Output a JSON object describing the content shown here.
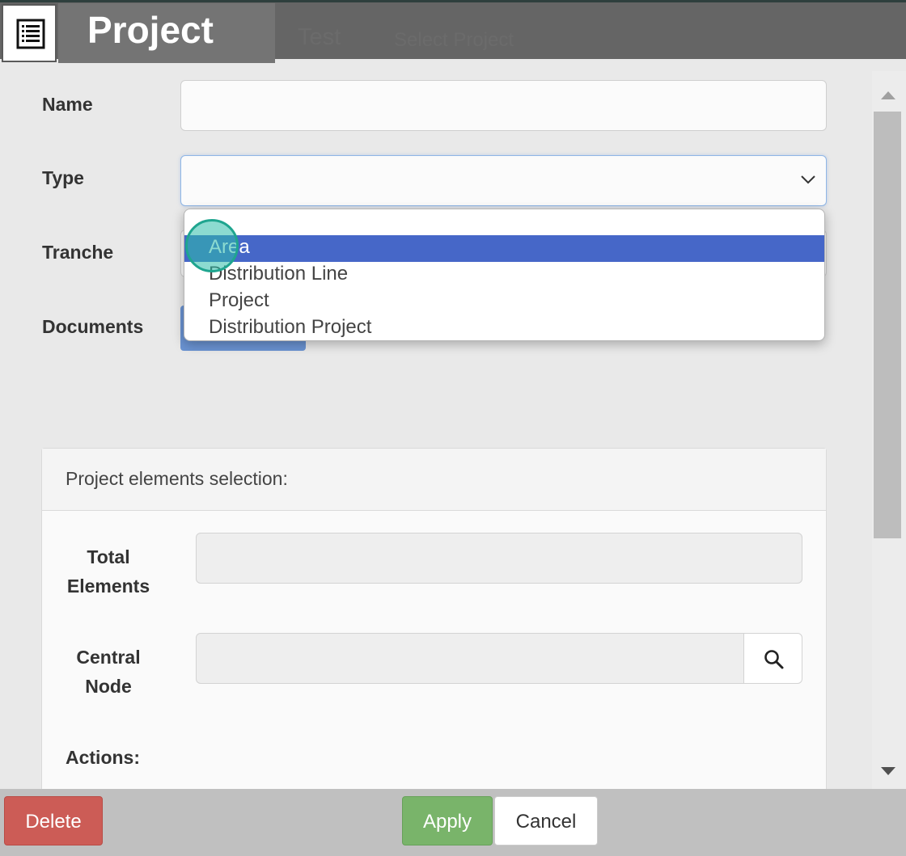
{
  "window": {
    "title": "Project",
    "background_text": [
      "Test",
      "Select Project"
    ]
  },
  "form": {
    "name_label": "Name",
    "name_value": "",
    "type_label": "Type",
    "type_value": "",
    "tranche_label": "Tranche",
    "documents_label": "Documents"
  },
  "type_dropdown": {
    "options": [
      "",
      "Area",
      "Distribution Line",
      "Project",
      "Distribution Project"
    ],
    "highlighted": "Area"
  },
  "panel": {
    "title": "Project elements selection:",
    "total_elements_label_1": "Total",
    "total_elements_label_2": "Elements",
    "total_elements_value": "",
    "central_node_label_1": "Central",
    "central_node_label_2": "Node",
    "central_node_value": "",
    "actions_label": "Actions:"
  },
  "footer": {
    "delete_label": "Delete",
    "apply_label": "Apply",
    "cancel_label": "Cancel"
  },
  "colors": {
    "delete": "#cc5c56",
    "apply": "#79b46a",
    "highlight": "#4667c8",
    "title_bar": "#656565"
  }
}
